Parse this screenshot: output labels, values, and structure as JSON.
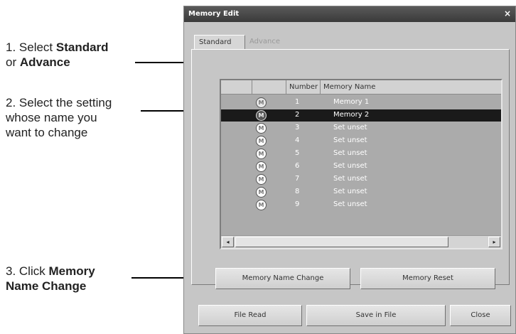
{
  "annotations": {
    "step1": {
      "prefix": "1. Select ",
      "bold1": "Standard",
      "line2_prefix": "or ",
      "bold2": "Advance"
    },
    "step2": {
      "line1": "2. Select the setting",
      "line2": "whose name you",
      "line3": "want to change"
    },
    "step3": {
      "prefix": "3. Click ",
      "bold1": "Memory",
      "bold2": "Name Change"
    }
  },
  "dialog": {
    "title": "Memory Edit",
    "close_glyph": "×",
    "tabs": [
      {
        "label": "Standard",
        "active": true
      },
      {
        "label": "Advance",
        "active": false
      }
    ],
    "list": {
      "columns": [
        "",
        "",
        "Number",
        "Memory Name"
      ],
      "rows": [
        {
          "icon": "M",
          "number": "1",
          "name": "Memory 1",
          "selected": false
        },
        {
          "icon": "M",
          "number": "2",
          "name": "Memory 2",
          "selected": true
        },
        {
          "icon": "M",
          "number": "3",
          "name": "Set unset",
          "selected": false
        },
        {
          "icon": "M",
          "number": "4",
          "name": "Set unset",
          "selected": false
        },
        {
          "icon": "M",
          "number": "5",
          "name": "Set unset",
          "selected": false
        },
        {
          "icon": "M",
          "number": "6",
          "name": "Set unset",
          "selected": false
        },
        {
          "icon": "M",
          "number": "7",
          "name": "Set unset",
          "selected": false
        },
        {
          "icon": "M",
          "number": "8",
          "name": "Set unset",
          "selected": false
        },
        {
          "icon": "M",
          "number": "9",
          "name": "Set unset",
          "selected": false
        }
      ],
      "scroll_left": "◂",
      "scroll_right": "▸"
    },
    "buttons": {
      "memory_name_change": "Memory Name Change",
      "memory_reset": "Memory Reset",
      "file_read": "File Read",
      "save_in_file": "Save in File",
      "close": "Close"
    }
  }
}
